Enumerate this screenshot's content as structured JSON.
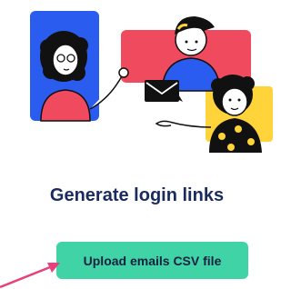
{
  "main": {
    "heading": "Generate login links",
    "upload_button_label": "Upload emails CSV file"
  },
  "colors": {
    "heading": "#1a2b5e",
    "button_bg": "#3fd3a5",
    "arrow": "#e8407a",
    "blue_panel": "#2b5cf0",
    "pink_panel": "#f04a5e",
    "yellow_panel": "#ffd33a"
  },
  "icons": {
    "illustration": "people-sharing-email-illustration",
    "arrow": "pointer-arrow-icon",
    "envelope": "envelope-icon"
  }
}
